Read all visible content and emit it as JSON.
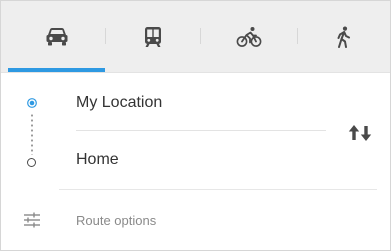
{
  "tabs": [
    {
      "icon": "car-icon",
      "name": "Driving",
      "selected": true
    },
    {
      "icon": "transit-icon",
      "name": "Transit",
      "selected": false
    },
    {
      "icon": "bicycle-icon",
      "name": "Bicycling",
      "selected": false
    },
    {
      "icon": "walking-icon",
      "name": "Walking",
      "selected": false
    }
  ],
  "route": {
    "origin": "My Location",
    "destination": "Home",
    "swap_icon": "swap-arrows-icon"
  },
  "options": {
    "label": "Route options",
    "icon": "sliders-icon"
  },
  "colors": {
    "accent": "#2e99e2",
    "tab_bar": "#eeeeee",
    "icon": "#4a4a4a",
    "text": "#333333",
    "muted_text": "#8a8a8a"
  }
}
